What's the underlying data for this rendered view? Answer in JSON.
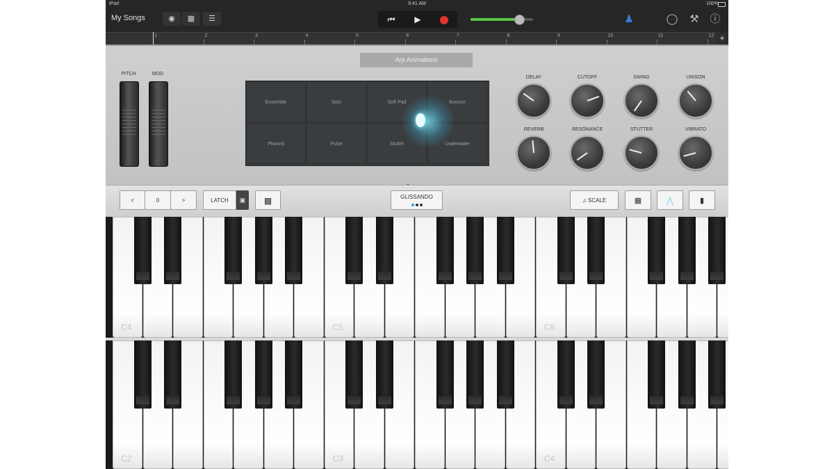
{
  "status_bar": {
    "device": "iPad",
    "time": "9:41 AM",
    "battery": "100%"
  },
  "toolbar": {
    "my_songs": "My Songs",
    "view_icons": [
      "browser-icon",
      "tracks-icon",
      "mixer-icon"
    ],
    "transport_icons": [
      "rewind-icon",
      "play-icon",
      "record-icon"
    ],
    "volume_level": 0.78,
    "right_icons": [
      "metronome-icon",
      "loop-icon",
      "settings-wrench-icon",
      "help-icon"
    ]
  },
  "ruler": {
    "bars": [
      "1",
      "2",
      "3",
      "4",
      "5",
      "6",
      "7",
      "8",
      "9",
      "10",
      "11",
      "12"
    ]
  },
  "synth": {
    "patch_button": "Arp Animations",
    "wheels": {
      "pitch": "PITCH",
      "mod": "MOD"
    },
    "arp_cells": [
      "Ensemble",
      "Solo",
      "Soft Pad",
      "Bounce",
      "Phased",
      "Pulse",
      "Stutter",
      "Underwater"
    ],
    "knobs": [
      {
        "label": "DELAY",
        "angle": 125
      },
      {
        "label": "CUTOFF",
        "angle": -110
      },
      {
        "label": "SWING",
        "angle": 35
      },
      {
        "label": "UNISON",
        "angle": 140
      },
      {
        "label": "REVERB",
        "angle": 175
      },
      {
        "label": "RESONANCE",
        "angle": 55
      },
      {
        "label": "STUTTER",
        "angle": 105
      },
      {
        "label": "VIBRATO",
        "angle": 75
      }
    ]
  },
  "controls": {
    "octave_down": "<",
    "octave_value": "0",
    "octave_up": ">",
    "latch": "LATCH",
    "glissando": "GLISSANDO",
    "scale": "SCALE"
  },
  "keyboards": [
    {
      "octave_labels": [
        "C4",
        "C5",
        "C6"
      ]
    },
    {
      "octave_labels": [
        "C2",
        "C3",
        "C4"
      ]
    }
  ]
}
